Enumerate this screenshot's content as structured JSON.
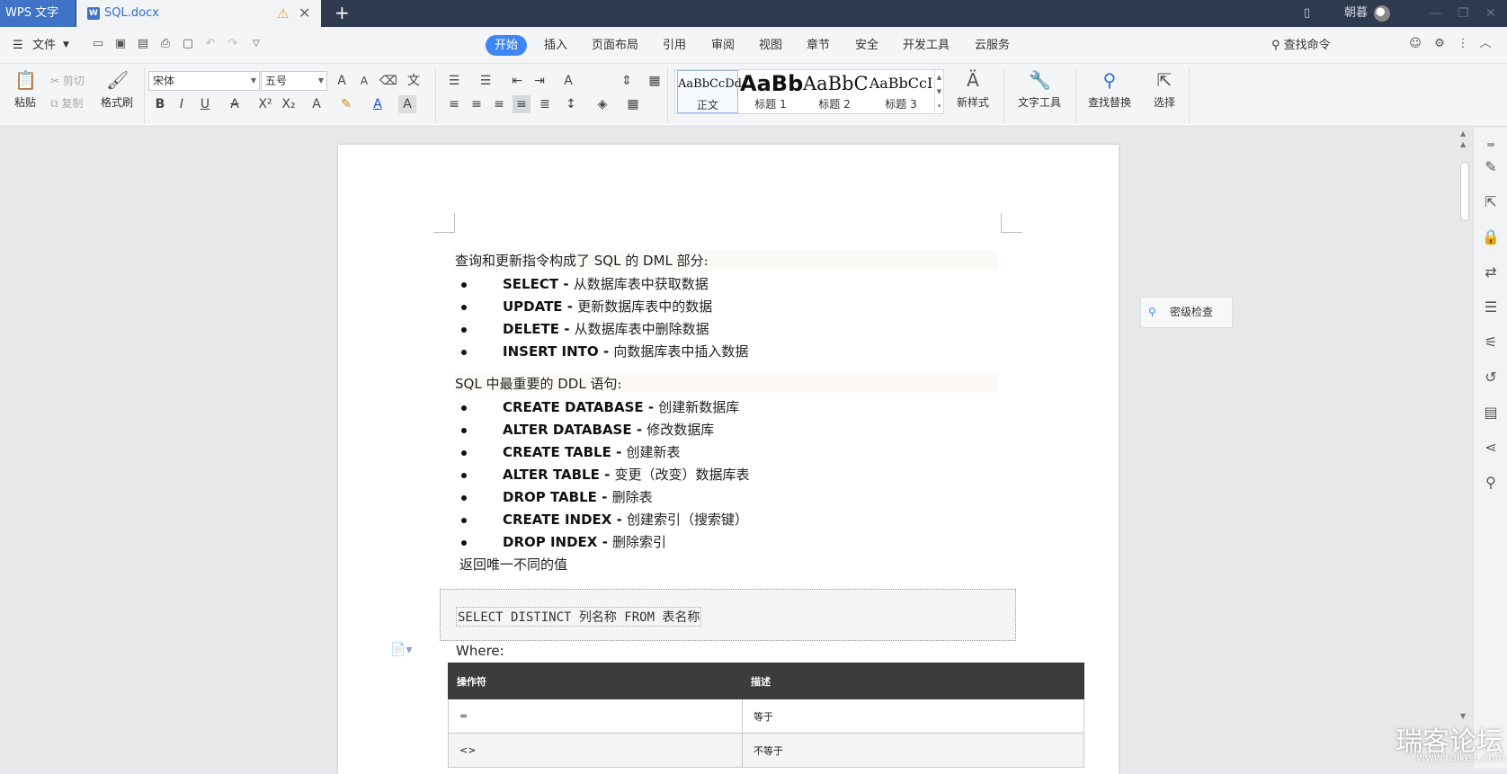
{
  "titlebar": {
    "app_name": "WPS 文字",
    "doc_tab": "SQL.docx",
    "user": "朝暮"
  },
  "menubar": {
    "file_label": "文件",
    "tabs": [
      "开始",
      "插入",
      "页面布局",
      "引用",
      "审阅",
      "视图",
      "章节",
      "安全",
      "开发工具",
      "云服务"
    ],
    "active_tab": "开始",
    "search_label": "查找命令"
  },
  "ribbon": {
    "paste": "粘贴",
    "cut": "剪切",
    "copy": "复制",
    "format_painter": "格式刷",
    "font_name": "宋体",
    "font_size": "五号",
    "styles": [
      {
        "preview": "AaBbCcDd",
        "label": "正文"
      },
      {
        "preview": "AaBb",
        "label": "标题 1"
      },
      {
        "preview": "AaBbC",
        "label": "标题 2"
      },
      {
        "preview": "AaBbCcI",
        "label": "标题 3"
      }
    ],
    "new_style": "新样式",
    "text_tools": "文字工具",
    "find_replace": "查找替换",
    "select": "选择"
  },
  "floating": {
    "secret_check": "密级检查"
  },
  "document": {
    "dml_intro": {
      "a": "查询和更新指令构成了 ",
      "b": "SQL",
      "c": " 的 ",
      "d": "DML",
      "e": " 部分:"
    },
    "dml_items": [
      {
        "kw": "SELECT - ",
        "desc": "从数据库表中获取数据"
      },
      {
        "kw": "UPDATE - ",
        "desc": "更新数据库表中的数据"
      },
      {
        "kw": "DELETE - ",
        "desc": "从数据库表中删除数据"
      },
      {
        "kw": "INSERT INTO - ",
        "desc": "向数据库表中插入数据"
      }
    ],
    "ddl_intro": {
      "a": "SQL",
      "b": " 中最重要的 ",
      "c": "DDL",
      "d": " 语句:"
    },
    "ddl_items": [
      {
        "kw": "CREATE DATABASE - ",
        "desc": "创建新数据库"
      },
      {
        "kw": "ALTER DATABASE - ",
        "desc": "修改数据库"
      },
      {
        "kw": "CREATE TABLE - ",
        "desc": "创建新表"
      },
      {
        "kw": "ALTER TABLE - ",
        "desc": "变更（改变）数据库表"
      },
      {
        "kw": "DROP TABLE - ",
        "desc": "删除表"
      },
      {
        "kw": "CREATE INDEX - ",
        "desc": "创建索引（搜索键）"
      },
      {
        "kw": "DROP INDEX - ",
        "desc": "删除索引"
      }
    ],
    "distinct_note": "返回唯一不同的值",
    "code": "SELECT DISTINCT 列名称 FROM 表名称",
    "where_label": "Where:",
    "table": {
      "headers": [
        "操作符",
        "描述"
      ],
      "rows": [
        [
          "=",
          "等于"
        ],
        [
          "<>",
          "不等于"
        ]
      ]
    }
  },
  "watermark": {
    "main": "瑞客论坛",
    "sub": "www.ruike1.com"
  }
}
